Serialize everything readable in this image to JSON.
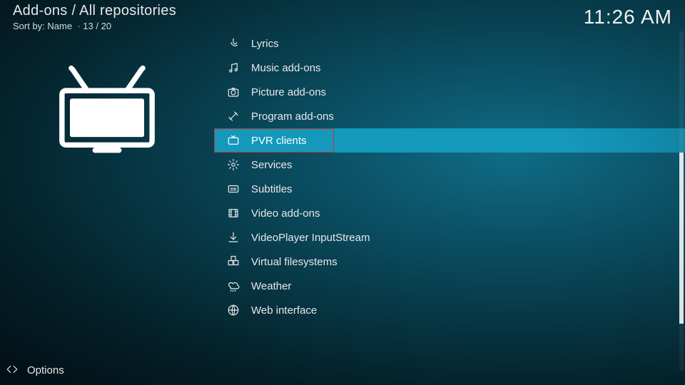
{
  "header": {
    "breadcrumb": "Add-ons / All repositories",
    "sort_prefix": "Sort by: ",
    "sort_field": "Name",
    "pos": "13 / 20"
  },
  "clock": "11:26 AM",
  "selected_index": 4,
  "categories": [
    {
      "icon": "mic-icon",
      "label": "Lyrics"
    },
    {
      "icon": "music-icon",
      "label": "Music add-ons"
    },
    {
      "icon": "camera-icon",
      "label": "Picture add-ons"
    },
    {
      "icon": "tools-icon",
      "label": "Program add-ons"
    },
    {
      "icon": "tv-icon",
      "label": "PVR clients"
    },
    {
      "icon": "gear-icon",
      "label": "Services"
    },
    {
      "icon": "subtitle-icon",
      "label": "Subtitles"
    },
    {
      "icon": "film-icon",
      "label": "Video add-ons"
    },
    {
      "icon": "download-icon",
      "label": "VideoPlayer InputStream"
    },
    {
      "icon": "boxes-icon",
      "label": "Virtual filesystems"
    },
    {
      "icon": "weather-icon",
      "label": "Weather"
    },
    {
      "icon": "globe-icon",
      "label": "Web interface"
    }
  ],
  "footer": {
    "options_label": "Options"
  },
  "highlight": {
    "target_index": 4
  },
  "colors": {
    "accent": "#1498bc",
    "highlight_border": "#c0392b"
  }
}
